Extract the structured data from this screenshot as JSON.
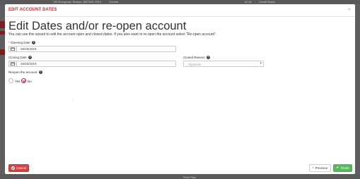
{
  "background": {
    "top_address": "790 Evergreen Terrace, BRTN01 2013",
    "top_status": "Current",
    "top_amount": "£0.00",
    "top_credit": "Credit Status",
    "bottom_text": "Price Plan"
  },
  "modal": {
    "title": "EDIT ACCOUNT DATES",
    "close_glyph": "×",
    "heading": "Edit Dates and/or re-open account",
    "description": "You can use this wizard to edit the account open and closed dates. If you also want to re-open the account select \"Re-open account\".",
    "opening_date": {
      "required_mark": "*",
      "label": "Opening Date",
      "value": "05/05/2018"
    },
    "closing_date": {
      "label": "Closing Date",
      "value": "25/03/2019"
    },
    "closed_reason": {
      "label": "Closed Reason",
      "placeholder": "- Optional -"
    },
    "reopen": {
      "label": "Reopen the account",
      "options": [
        {
          "label": "Yes",
          "checked": false
        },
        {
          "label": "No",
          "checked": true
        }
      ]
    },
    "stray_mark": "⌄",
    "buttons": {
      "cancel": "Cancel",
      "previous": "Previous",
      "finish": "Finish"
    }
  },
  "colors": {
    "title_red": "#b52e2e",
    "cancel_red": "#d14444",
    "finish_green": "#5cb85c"
  }
}
